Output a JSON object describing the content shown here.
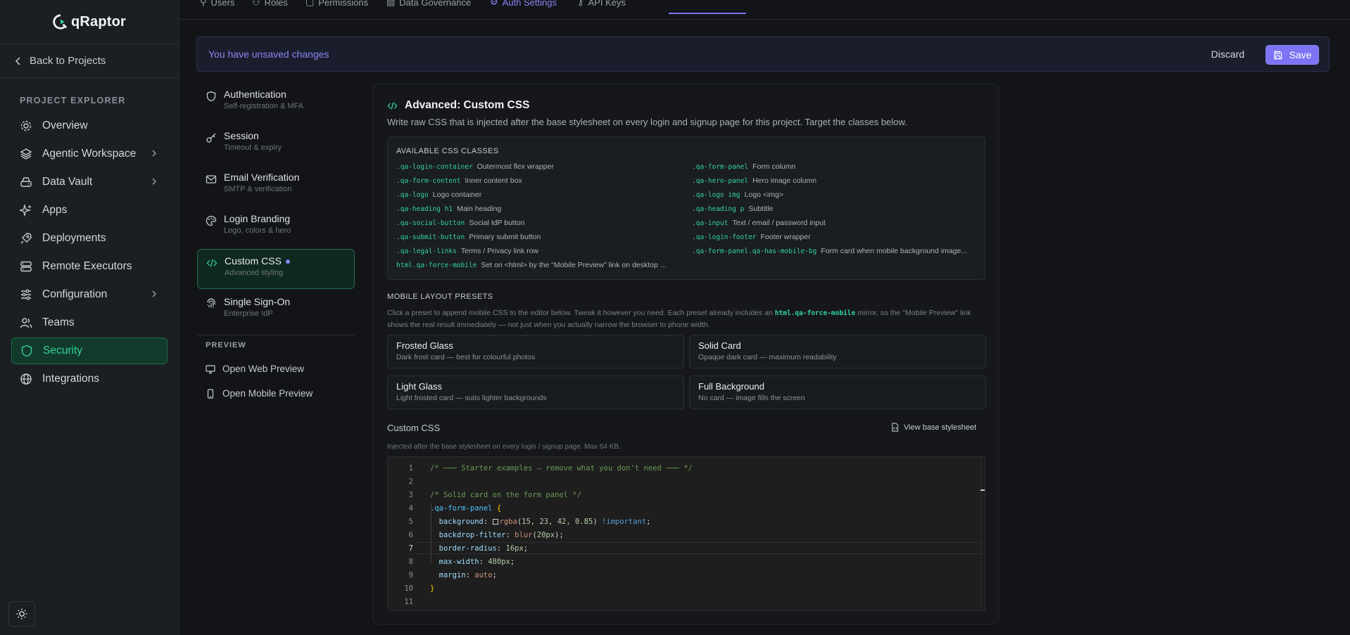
{
  "brand": {
    "name": "qRaptor"
  },
  "sidebar": {
    "back_label": "Back to Projects",
    "section_title": "PROJECT EXPLORER",
    "items": [
      {
        "label": "Overview",
        "icon": "gear-icon"
      },
      {
        "label": "Agentic Workspace",
        "icon": "layers-icon"
      },
      {
        "label": "Data Vault",
        "icon": "drive-icon"
      },
      {
        "label": "Apps",
        "icon": "sparkle-icon"
      },
      {
        "label": "Deployments",
        "icon": "rocket-icon"
      },
      {
        "label": "Remote Executors",
        "icon": "server-icon"
      },
      {
        "label": "Configuration",
        "icon": "sliders-icon"
      },
      {
        "label": "Teams",
        "icon": "users-icon"
      },
      {
        "label": "Security",
        "icon": "shield-icon"
      },
      {
        "label": "Integrations",
        "icon": "globe-icon"
      }
    ]
  },
  "tabs": [
    {
      "label": "Users"
    },
    {
      "label": "Roles"
    },
    {
      "label": "Permissions"
    },
    {
      "label": "Data Governance"
    },
    {
      "label": "Auth Settings"
    },
    {
      "label": "API Keys"
    }
  ],
  "banner": {
    "text": "You have unsaved changes",
    "discard": "Discard",
    "save": "Save"
  },
  "subnav": {
    "items": [
      {
        "title": "Authentication",
        "desc": "Self-registration & MFA"
      },
      {
        "title": "Session",
        "desc": "Timeout & expiry"
      },
      {
        "title": "Email Verification",
        "desc": "SMTP & verification"
      },
      {
        "title": "Login Branding",
        "desc": "Logo, colors & hero"
      },
      {
        "title": "Custom CSS",
        "desc": "Advanced styling"
      },
      {
        "title": "Single Sign-On",
        "desc": "Enterprise IdP"
      }
    ],
    "preview_title": "PREVIEW",
    "web_preview": "Open Web Preview",
    "mobile_preview": "Open Mobile Preview"
  },
  "panel": {
    "title": "Advanced: Custom CSS",
    "subtitle": "Write raw CSS that is injected after the base stylesheet on every login and signup page for this project. Target the classes below.",
    "classes_title": "AVAILABLE CSS CLASSES",
    "classes": [
      {
        "name": ".qa-login-container",
        "desc": "Outermost flex wrapper"
      },
      {
        "name": ".qa-form-panel",
        "desc": "Form column"
      },
      {
        "name": ".qa-form-content",
        "desc": "Inner content box"
      },
      {
        "name": ".qa-hero-panel",
        "desc": "Hero image column"
      },
      {
        "name": ".qa-logo",
        "desc": "Logo container"
      },
      {
        "name": ".qa-logo img",
        "desc": "Logo <img>"
      },
      {
        "name": ".qa-heading h1",
        "desc": "Main heading"
      },
      {
        "name": ".qa-heading p",
        "desc": "Subtitle"
      },
      {
        "name": ".qa-social-button",
        "desc": "Social IdP button"
      },
      {
        "name": ".qa-input",
        "desc": "Text / email / password input"
      },
      {
        "name": ".qa-submit-button",
        "desc": "Primary submit button"
      },
      {
        "name": ".qa-login-footer",
        "desc": "Footer wrapper"
      },
      {
        "name": ".qa-legal-links",
        "desc": "Terms / Privacy link row"
      },
      {
        "name": ".qa-form-panel.qa-has-mobile-bg",
        "desc": "Form card when mobile background image..."
      },
      {
        "name": "html.qa-force-mobile",
        "desc": "Set on <html> by the \"Mobile Preview\" link on desktop ..."
      }
    ],
    "presets_title": "MOBILE LAYOUT PRESETS",
    "presets_desc_1": "Click a preset to append mobile CSS to the editor below. Tweak it however you need. Each preset already includes an",
    "presets_desc_code": "html.qa-force-mobile",
    "presets_desc_2": "mirror, so the \"Mobile Preview\" link shows the real result immediately — not just when you actually narrow the browser to phone width.",
    "presets": [
      {
        "name": "Frosted Glass",
        "desc": "Dark frost card — best for colourful photos"
      },
      {
        "name": "Solid Card",
        "desc": "Opaque dark card — maximum readability"
      },
      {
        "name": "Light Glass",
        "desc": "Light frosted card — suits lighter backgrounds"
      },
      {
        "name": "Full Background",
        "desc": "No card — image fills the screen"
      }
    ],
    "css_label": "Custom CSS",
    "view_base": "View base stylesheet",
    "css_help": "Injected after the base stylesheet on every login / signup page. Max 64 KB.",
    "code_lines": [
      "1",
      "2",
      "3",
      "4",
      "5",
      "6",
      "7",
      "8",
      "9",
      "10",
      "11"
    ]
  },
  "editor": {
    "comment1": "/* ─── Starter examples — remove what you don't need ─── */",
    "comment2": "/* Solid card on the form panel */",
    "selector": ".qa-form-panel",
    "open_brace": "{",
    "close_brace": "}",
    "background_prop": "background",
    "background_fn": "rgba",
    "background_args": "15, 23, 42, 0.85",
    "important": "!important",
    "backdrop_prop": "backdrop-filter",
    "backdrop_fn": "blur",
    "backdrop_arg": "20px",
    "radius_prop": "border-radius",
    "radius_val": "16px",
    "maxw_prop": "max-width",
    "maxw_val": "480px",
    "margin_prop": "margin",
    "margin_val": "auto"
  },
  "colors": {
    "accent": "#34d399",
    "primary": "#7c74f3"
  }
}
